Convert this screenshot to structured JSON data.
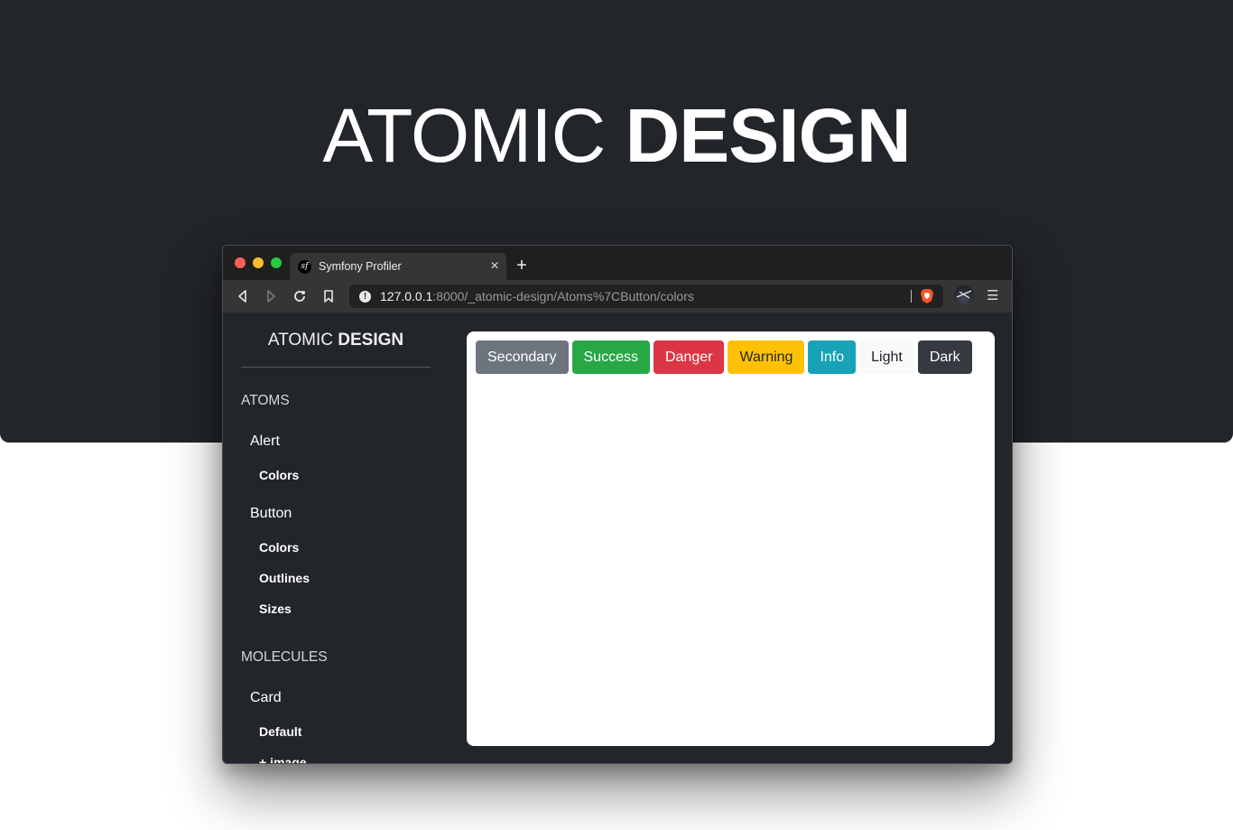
{
  "hero": {
    "title_light": "ATOMIC",
    "title_bold": "DESIGN"
  },
  "browser": {
    "tab": {
      "title": "Symfony Profiler",
      "favicon": "sf",
      "close_icon": "×"
    },
    "new_tab_icon": "+",
    "url": {
      "host": "127.0.0.1",
      "rest": ":8000/_atomic-design/Atoms%7CButton/colors",
      "security_icon": "!"
    },
    "menu_icon": "☰"
  },
  "sidebar": {
    "brand_light": "ATOMIC",
    "brand_bold": "DESIGN",
    "sections": [
      {
        "label": "ATOMS",
        "groups": [
          {
            "label": "Alert",
            "items": [
              "Colors"
            ]
          },
          {
            "label": "Button",
            "items": [
              "Colors",
              "Outlines",
              "Sizes"
            ]
          }
        ]
      },
      {
        "label": "MOLECULES",
        "groups": [
          {
            "label": "Card",
            "items": [
              "Default",
              "+ image"
            ]
          }
        ]
      }
    ]
  },
  "buttons": [
    {
      "label": "Secondary",
      "bg": "#6c757d",
      "fg": "#ffffff"
    },
    {
      "label": "Success",
      "bg": "#28a745",
      "fg": "#ffffff"
    },
    {
      "label": "Danger",
      "bg": "#dc3545",
      "fg": "#ffffff"
    },
    {
      "label": "Warning",
      "bg": "#ffc107",
      "fg": "#212529"
    },
    {
      "label": "Info",
      "bg": "#17a2b8",
      "fg": "#ffffff"
    },
    {
      "label": "Light",
      "bg": "#f8f9fa",
      "fg": "#212529"
    },
    {
      "label": "Dark",
      "bg": "#343a40",
      "fg": "#ffffff"
    }
  ]
}
